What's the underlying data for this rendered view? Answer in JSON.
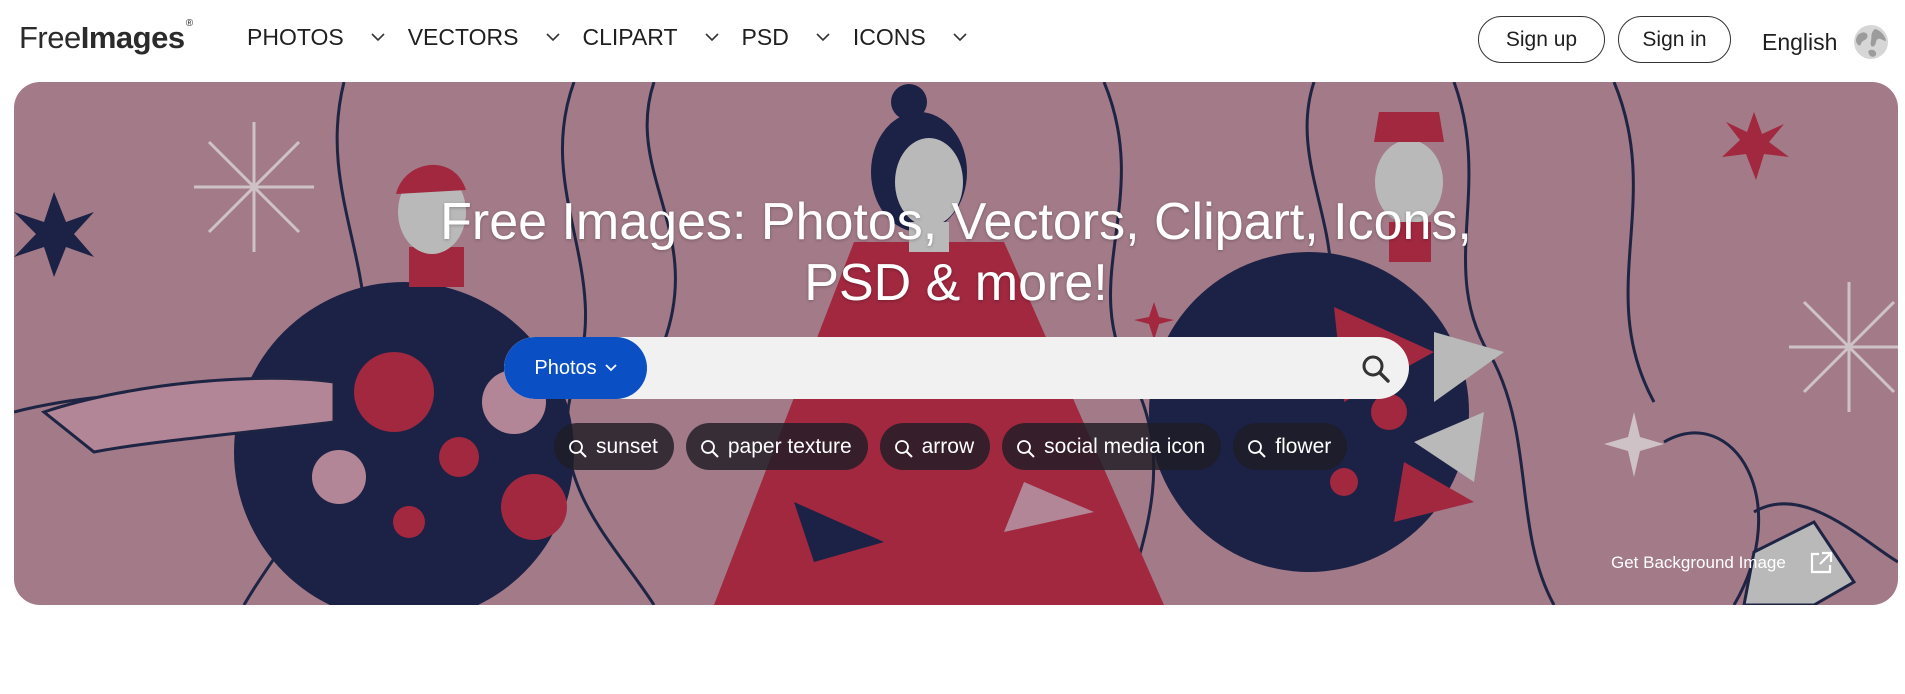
{
  "logo": {
    "part1": "Free",
    "part2": "Images",
    "reg": "®"
  },
  "nav": {
    "items": [
      {
        "label": "PHOTOS"
      },
      {
        "label": "VECTORS"
      },
      {
        "label": "CLIPART"
      },
      {
        "label": "PSD"
      },
      {
        "label": "ICONS"
      }
    ]
  },
  "auth": {
    "signup_label": "Sign up",
    "signin_label": "Sign in"
  },
  "language": {
    "label": "English",
    "icon": "globe-icon"
  },
  "hero": {
    "title_line1": "Free Images: Photos, Vectors, Clipart, Icons,",
    "title_line2": "PSD & more!",
    "background_color": "#a27a88",
    "get_background_label": "Get Background Image"
  },
  "search": {
    "category": "Photos",
    "placeholder": "",
    "value": "",
    "accent_color": "#0a4fc4"
  },
  "tags": [
    "sunset",
    "paper texture",
    "arrow",
    "social media icon",
    "flower"
  ]
}
